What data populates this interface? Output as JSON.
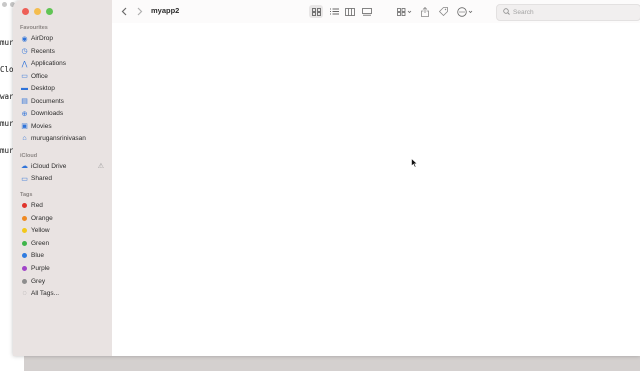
{
  "terminal": {
    "lines": [
      "muru",
      "Clor",
      "warr",
      "muru",
      "muru"
    ]
  },
  "window": {
    "title": "myapp2"
  },
  "colors": {
    "close": "#ee5f57",
    "minimize": "#f4bd4f",
    "zoom": "#60c454",
    "accent": "#2f73d9"
  },
  "sidebar": {
    "favourites_title": "Favourites",
    "favourites": [
      {
        "label": "AirDrop",
        "icon": "airdrop-icon"
      },
      {
        "label": "Recents",
        "icon": "clock-icon"
      },
      {
        "label": "Applications",
        "icon": "applications-icon"
      },
      {
        "label": "Office",
        "icon": "folder-icon"
      },
      {
        "label": "Desktop",
        "icon": "desktop-icon"
      },
      {
        "label": "Documents",
        "icon": "document-icon"
      },
      {
        "label": "Downloads",
        "icon": "download-icon"
      },
      {
        "label": "Movies",
        "icon": "movies-icon"
      },
      {
        "label": "murugansrinivasan",
        "icon": "home-icon"
      }
    ],
    "icloud_title": "iCloud",
    "icloud": [
      {
        "label": "iCloud Drive",
        "icon": "cloud-icon"
      },
      {
        "label": "Shared",
        "icon": "shared-folder-icon"
      }
    ],
    "tags_title": "Tags",
    "tags": [
      {
        "label": "Red",
        "color": "#e0342c"
      },
      {
        "label": "Orange",
        "color": "#ef8a23"
      },
      {
        "label": "Yellow",
        "color": "#f3c81c"
      },
      {
        "label": "Green",
        "color": "#3fb54a"
      },
      {
        "label": "Blue",
        "color": "#2f7be0"
      },
      {
        "label": "Purple",
        "color": "#a145c9"
      },
      {
        "label": "Grey",
        "color": "#8d8d8d"
      }
    ],
    "all_tags": "All Tags..."
  },
  "toolbar": {
    "back_icon": "chevron-left-icon",
    "forward_icon": "chevron-right-icon",
    "view_icons": [
      "icon-view-icon",
      "list-view-icon",
      "column-view-icon",
      "gallery-view-icon"
    ],
    "group_icon": "group-icon",
    "share_icon": "share-icon",
    "tag_icon": "tag-icon",
    "more_icon": "more-icon",
    "search_placeholder": "Search"
  }
}
